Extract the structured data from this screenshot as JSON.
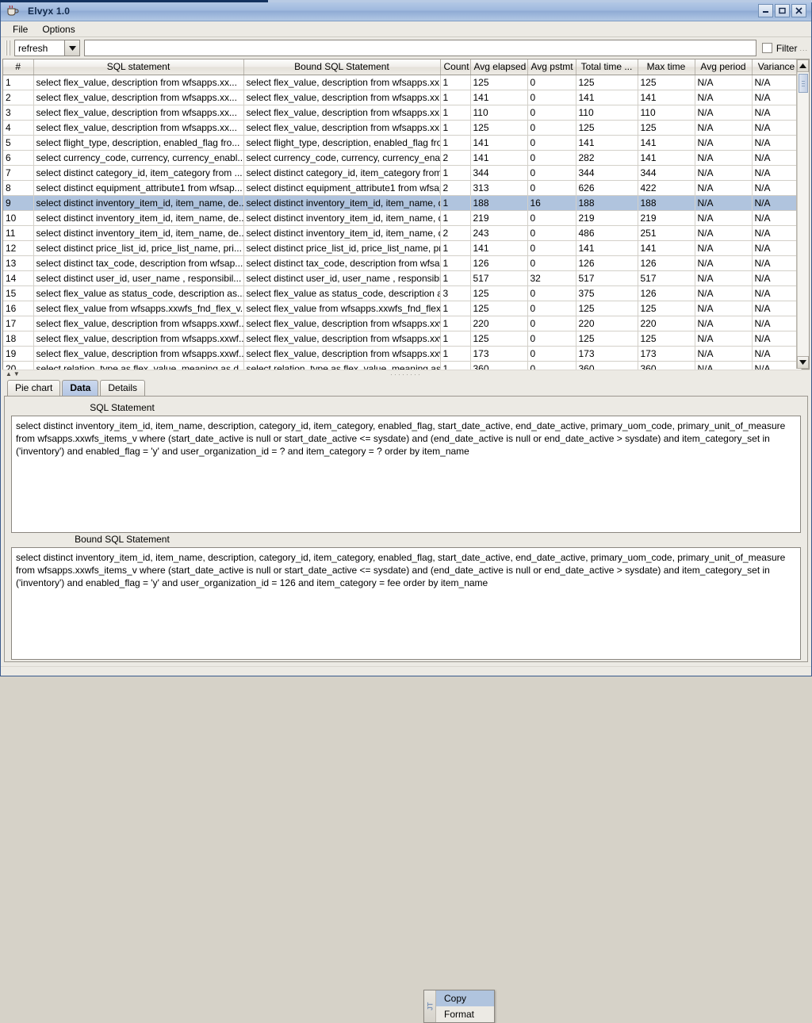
{
  "window": {
    "title": "Elvyx 1.0",
    "app_icon": "coffee-cup-icon",
    "minimize_label": "–",
    "maximize_label": "□",
    "close_label": "✕"
  },
  "menubar": {
    "items": [
      {
        "label": "File"
      },
      {
        "label": "Options"
      }
    ]
  },
  "toolbar": {
    "action_combo": {
      "value": "refresh"
    },
    "filter_input": {
      "value": "",
      "placeholder": ""
    },
    "filter_checkbox_checked": false,
    "filter_label": "Filter",
    "filter_dots": "..."
  },
  "table": {
    "columns": [
      {
        "key": "idx",
        "label": "#"
      },
      {
        "key": "sql",
        "label": "SQL statement"
      },
      {
        "key": "bound_sql",
        "label": "Bound SQL Statement"
      },
      {
        "key": "count",
        "label": "Count"
      },
      {
        "key": "avg_elapsed",
        "label": "Avg elapsed"
      },
      {
        "key": "avg_pstmt",
        "label": "Avg pstmt"
      },
      {
        "key": "total_time",
        "label": "Total time ..."
      },
      {
        "key": "max_time",
        "label": "Max time"
      },
      {
        "key": "avg_period",
        "label": "Avg period"
      },
      {
        "key": "variance",
        "label": "Variance"
      }
    ],
    "selected_row_index": 8,
    "rows": [
      {
        "idx": "1",
        "sql": "select  flex_value, description  from wfsapps.xx...",
        "bound_sql": "select  flex_value, description  from wfsapps.xx...",
        "count": "1",
        "avg_elapsed": "125",
        "avg_pstmt": "0",
        "total_time": "125",
        "max_time": "125",
        "avg_period": "N/A",
        "variance": "N/A"
      },
      {
        "idx": "2",
        "sql": "select  flex_value, description  from wfsapps.xx...",
        "bound_sql": "select  flex_value, description  from wfsapps.xx...",
        "count": "1",
        "avg_elapsed": "141",
        "avg_pstmt": "0",
        "total_time": "141",
        "max_time": "141",
        "avg_period": "N/A",
        "variance": "N/A"
      },
      {
        "idx": "3",
        "sql": "select  flex_value, description  from wfsapps.xx...",
        "bound_sql": "select  flex_value, description  from wfsapps.xx...",
        "count": "1",
        "avg_elapsed": "110",
        "avg_pstmt": "0",
        "total_time": "110",
        "max_time": "110",
        "avg_period": "N/A",
        "variance": "N/A"
      },
      {
        "idx": "4",
        "sql": "select  flex_value, description  from wfsapps.xx...",
        "bound_sql": "select  flex_value, description  from wfsapps.xx...",
        "count": "1",
        "avg_elapsed": "125",
        "avg_pstmt": "0",
        "total_time": "125",
        "max_time": "125",
        "avg_period": "N/A",
        "variance": "N/A"
      },
      {
        "idx": "5",
        "sql": "select flight_type, description, enabled_flag fro...",
        "bound_sql": "select flight_type, description, enabled_flag fro...",
        "count": "1",
        "avg_elapsed": "141",
        "avg_pstmt": "0",
        "total_time": "141",
        "max_time": "141",
        "avg_period": "N/A",
        "variance": "N/A"
      },
      {
        "idx": "6",
        "sql": "select currency_code, currency, currency_enabl...",
        "bound_sql": "select currency_code, currency, currency_enabl...",
        "count": "2",
        "avg_elapsed": "141",
        "avg_pstmt": "0",
        "total_time": "282",
        "max_time": "141",
        "avg_period": "N/A",
        "variance": "N/A"
      },
      {
        "idx": "7",
        "sql": "select distinct category_id, item_category from ...",
        "bound_sql": "select distinct category_id, item_category from ...",
        "count": "1",
        "avg_elapsed": "344",
        "avg_pstmt": "0",
        "total_time": "344",
        "max_time": "344",
        "avg_period": "N/A",
        "variance": "N/A"
      },
      {
        "idx": "8",
        "sql": "select distinct equipment_attribute1 from wfsap...",
        "bound_sql": "select distinct equipment_attribute1 from wfsap...",
        "count": "2",
        "avg_elapsed": "313",
        "avg_pstmt": "0",
        "total_time": "626",
        "max_time": "422",
        "avg_period": "N/A",
        "variance": "N/A"
      },
      {
        "idx": "9",
        "sql": "select distinct inventory_item_id, item_name, de...",
        "bound_sql": "select distinct inventory_item_id, item_name, de...",
        "count": "1",
        "avg_elapsed": "188",
        "avg_pstmt": "16",
        "total_time": "188",
        "max_time": "188",
        "avg_period": "N/A",
        "variance": "N/A"
      },
      {
        "idx": "10",
        "sql": "select distinct inventory_item_id, item_name, de...",
        "bound_sql": "select distinct inventory_item_id, item_name, de...",
        "count": "1",
        "avg_elapsed": "219",
        "avg_pstmt": "0",
        "total_time": "219",
        "max_time": "219",
        "avg_period": "N/A",
        "variance": "N/A"
      },
      {
        "idx": "11",
        "sql": "select distinct inventory_item_id, item_name, de...",
        "bound_sql": "select distinct inventory_item_id, item_name, de...",
        "count": "2",
        "avg_elapsed": "243",
        "avg_pstmt": "0",
        "total_time": "486",
        "max_time": "251",
        "avg_period": "N/A",
        "variance": "N/A"
      },
      {
        "idx": "12",
        "sql": "select distinct price_list_id, price_list_name, pri...",
        "bound_sql": "select distinct price_list_id, price_list_name, pri...",
        "count": "1",
        "avg_elapsed": "141",
        "avg_pstmt": "0",
        "total_time": "141",
        "max_time": "141",
        "avg_period": "N/A",
        "variance": "N/A"
      },
      {
        "idx": "13",
        "sql": "select distinct tax_code, description from wfsap...",
        "bound_sql": "select distinct tax_code, description from wfsap...",
        "count": "1",
        "avg_elapsed": "126",
        "avg_pstmt": "0",
        "total_time": "126",
        "max_time": "126",
        "avg_period": "N/A",
        "variance": "N/A"
      },
      {
        "idx": "14",
        "sql": "select distinct user_id, user_name , responsibil...",
        "bound_sql": "select distinct user_id, user_name , responsibil...",
        "count": "1",
        "avg_elapsed": "517",
        "avg_pstmt": "32",
        "total_time": "517",
        "max_time": "517",
        "avg_period": "N/A",
        "variance": "N/A"
      },
      {
        "idx": "15",
        "sql": "select flex_value as status_code, description as...",
        "bound_sql": "select flex_value as status_code, description as...",
        "count": "3",
        "avg_elapsed": "125",
        "avg_pstmt": "0",
        "total_time": "375",
        "max_time": "126",
        "avg_period": "N/A",
        "variance": "N/A"
      },
      {
        "idx": "16",
        "sql": "select flex_value from wfsapps.xxwfs_fnd_flex_v...",
        "bound_sql": "select flex_value from wfsapps.xxwfs_fnd_flex_v...",
        "count": "1",
        "avg_elapsed": "125",
        "avg_pstmt": "0",
        "total_time": "125",
        "max_time": "125",
        "avg_period": "N/A",
        "variance": "N/A"
      },
      {
        "idx": "17",
        "sql": "select flex_value, description from wfsapps.xxwf...",
        "bound_sql": "select flex_value, description from wfsapps.xxwf...",
        "count": "1",
        "avg_elapsed": "220",
        "avg_pstmt": "0",
        "total_time": "220",
        "max_time": "220",
        "avg_period": "N/A",
        "variance": "N/A"
      },
      {
        "idx": "18",
        "sql": "select flex_value, description from wfsapps.xxwf...",
        "bound_sql": "select flex_value, description from wfsapps.xxwf...",
        "count": "1",
        "avg_elapsed": "125",
        "avg_pstmt": "0",
        "total_time": "125",
        "max_time": "125",
        "avg_period": "N/A",
        "variance": "N/A"
      },
      {
        "idx": "19",
        "sql": "select flex_value, description from wfsapps.xxwf...",
        "bound_sql": "select flex_value, description from wfsapps.xxwf...",
        "count": "1",
        "avg_elapsed": "173",
        "avg_pstmt": "0",
        "total_time": "173",
        "max_time": "173",
        "avg_period": "N/A",
        "variance": "N/A"
      },
      {
        "idx": "20",
        "sql": "select relation_type as flex_value, meaning as d...",
        "bound_sql": "select relation_type as flex_value, meaning as d...",
        "count": "1",
        "avg_elapsed": "360",
        "avg_pstmt": "0",
        "total_time": "360",
        "max_time": "360",
        "avg_period": "N/A",
        "variance": "N/A"
      }
    ]
  },
  "splitter": {
    "arrows": "▲▼",
    "dots": "········"
  },
  "tabs": [
    {
      "label": "Pie chart",
      "active": false
    },
    {
      "label": "Data",
      "active": true
    },
    {
      "label": "Details",
      "active": false
    }
  ],
  "detail": {
    "sql_statement_label": "SQL Statement",
    "sql_statement_value": "select distinct inventory_item_id, item_name, description, category_id, item_category, enabled_flag, start_date_active, end_date_active, primary_uom_code, primary_unit_of_measure from wfsapps.xxwfs_items_v where (start_date_active is null or start_date_active <= sysdate) and (end_date_active is null or end_date_active > sysdate) and item_category_set in ('inventory') and enabled_flag = 'y' and user_organization_id = ? and item_category = ? order by item_name",
    "bound_sql_label": "Bound SQL Statement",
    "bound_sql_value": "select distinct inventory_item_id, item_name, description, category_id, item_category, enabled_flag, start_date_active, end_date_active, primary_uom_code, primary_unit_of_measure from wfsapps.xxwfs_items_v where (start_date_active is null or start_date_active <= sysdate) and (end_date_active is null or end_date_active > sysdate) and item_category_set in ('inventory') and enabled_flag = 'y' and user_organization_id = 126 and item_category = fee order by item_name"
  },
  "popup_menu": {
    "grip_label": "JT",
    "items": [
      {
        "label": "Copy",
        "hovered": true
      },
      {
        "label": "Format",
        "hovered": false
      }
    ]
  },
  "colors": {
    "selection_blue": "#b0c4de",
    "titlebar_blue": "#9fb9de",
    "panel_gray": "#eceae4",
    "grid_line": "#d3d0c9"
  }
}
